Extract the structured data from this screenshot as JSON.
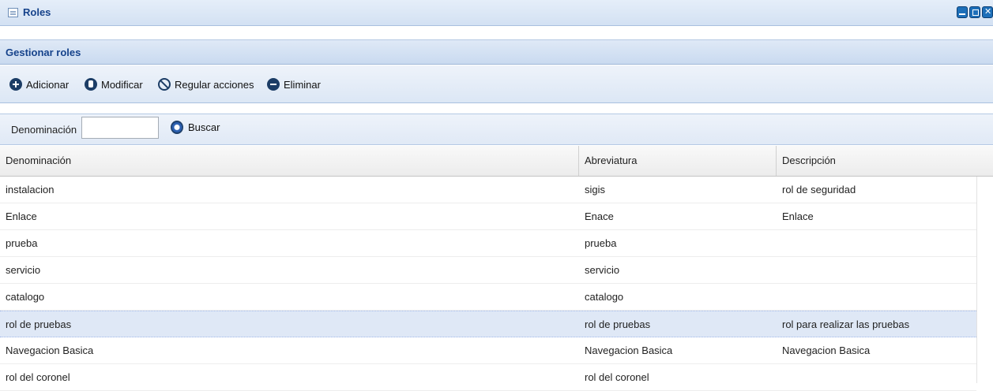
{
  "window": {
    "title": "Roles",
    "panel_title": "Gestionar roles"
  },
  "toolbar": {
    "add_label": "Adicionar",
    "edit_label": "Modificar",
    "actions_label": "Regular acciones",
    "delete_label": "Eliminar"
  },
  "search": {
    "label": "Denominación",
    "value": "",
    "button_label": "Buscar"
  },
  "grid": {
    "columns": [
      "Denominación",
      "Abreviatura",
      "Descripción"
    ],
    "rows": [
      [
        "instalacion",
        "sigis",
        "rol de seguridad"
      ],
      [
        "Enlace",
        "Enace",
        "Enlace"
      ],
      [
        "prueba",
        "prueba",
        ""
      ],
      [
        "servicio",
        "servicio",
        ""
      ],
      [
        "catalogo",
        "catalogo",
        ""
      ],
      [
        "rol de pruebas",
        "rol de pruebas",
        "rol para realizar las pruebas"
      ],
      [
        "Navegacion Basica",
        "Navegacion Basica",
        "Navegacion Basica"
      ],
      [
        "rol del coronel",
        "rol del coronel",
        ""
      ]
    ],
    "selected_row": 5
  },
  "icons": {
    "title": "list-icon",
    "add": "plus-circle-icon",
    "edit": "edit-circle-icon",
    "actions": "ban-circle-icon",
    "delete": "minus-circle-icon",
    "search": "search-circle-icon"
  },
  "colors": {
    "title_text": "#15428b",
    "header_gradient_top": "#e5eef9",
    "selected_row": "#dfe8f6"
  }
}
